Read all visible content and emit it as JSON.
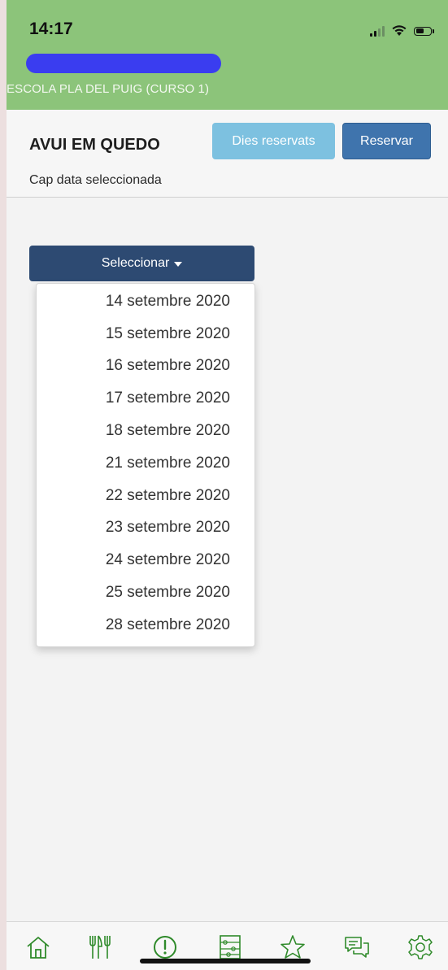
{
  "status_bar": {
    "time": "14:17"
  },
  "header": {
    "school": "ESCOLA PLA DEL PUIG (CURSO 1)"
  },
  "toolbar": {
    "title": "AVUI EM QUEDO",
    "days_button": "Dies reservats",
    "book_button": "Reservar",
    "subtitle": "Cap data seleccionada"
  },
  "select": {
    "label": "Seleccionar"
  },
  "dates": [
    "14 setembre 2020",
    "15 setembre 2020",
    "16 setembre 2020",
    "17 setembre 2020",
    "18 setembre 2020",
    "21 setembre 2020",
    "22 setembre 2020",
    "23 setembre 2020",
    "24 setembre 2020",
    "25 setembre 2020",
    "28 setembre 2020"
  ],
  "tabbar": {
    "icons": [
      "home-icon",
      "cutlery-icon",
      "alert-icon",
      "abacus-icon",
      "star-icon",
      "chat-icon",
      "gear-icon"
    ],
    "accent": "#2f8a2a"
  },
  "colors": {
    "header_bg": "#8cc47a",
    "days_button": "#7dc1e0",
    "book_button": "#3f74ad",
    "select_button": "#2d4a72",
    "redaction": "#3a3df0"
  }
}
